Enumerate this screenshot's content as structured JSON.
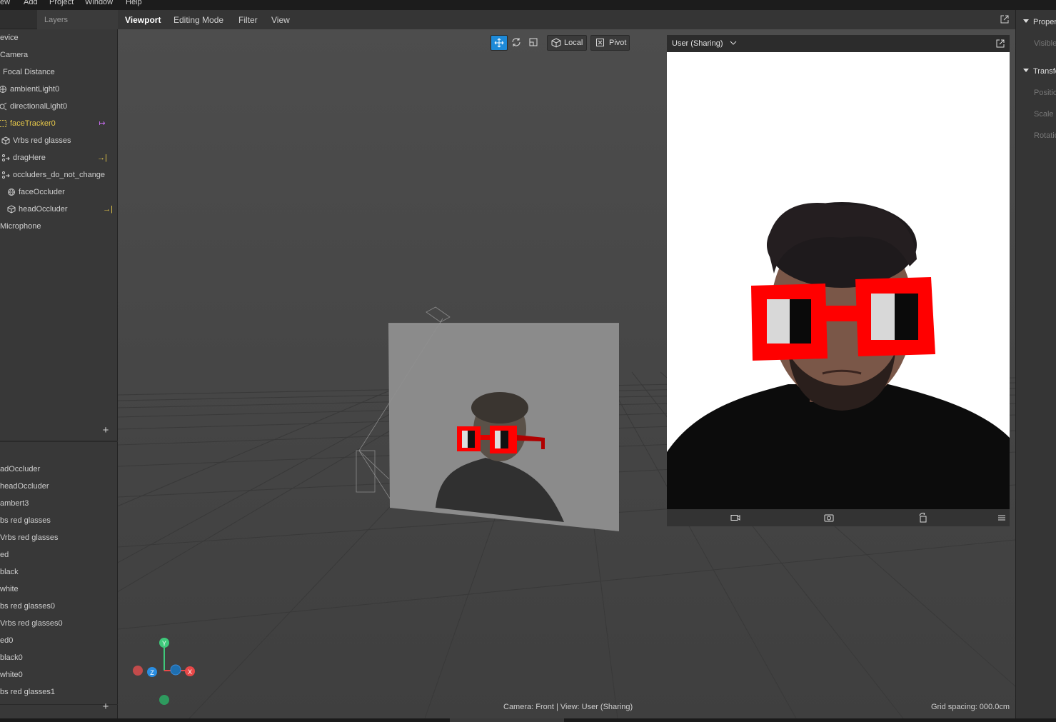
{
  "menu": [
    "ew",
    "Add",
    "Project",
    "Window",
    "Help"
  ],
  "layers_tab": "Layers",
  "scene_tree": [
    {
      "label": "evice",
      "icon": "none",
      "selected": false
    },
    {
      "label": "Camera",
      "icon": "none",
      "selected": false
    },
    {
      "label": "Focal Distance",
      "icon": "none",
      "selected": false
    },
    {
      "label": "ambientLight0",
      "icon": "ambient-light-icon",
      "selected": false
    },
    {
      "label": "directionalLight0",
      "icon": "directional-light-icon",
      "selected": false
    },
    {
      "label": "faceTracker0",
      "icon": "face-tracker-icon",
      "selected": true,
      "action": "↦"
    },
    {
      "label": "Vrbs red glasses",
      "icon": "cube-icon",
      "selected": false
    },
    {
      "label": "dragHere",
      "icon": "null-object-icon",
      "selected": false,
      "action": "→|"
    },
    {
      "label": "occluders_do_not_change",
      "icon": "null-object-icon",
      "selected": false
    },
    {
      "label": "faceOccluder",
      "icon": "face-mesh-icon",
      "selected": false
    },
    {
      "label": "headOccluder",
      "icon": "cube-icon",
      "selected": false,
      "action": "→|"
    },
    {
      "label": "Microphone",
      "icon": "none",
      "selected": false
    }
  ],
  "assets": [
    "adOccluder",
    "headOccluder",
    "ambert3",
    "bs red glasses",
    "Vrbs red glasses",
    "ed",
    "black",
    "white",
    "bs red glasses0",
    "Vrbs red glasses0",
    "ed0",
    "black0",
    "white0",
    "bs red glasses1"
  ],
  "add_label": "+",
  "viewport_tabs": [
    "Viewport",
    "Editing Mode",
    "Filter",
    "View"
  ],
  "toolbar": {
    "local": "Local",
    "pivot": "Pivot"
  },
  "preview": {
    "title": "User (Sharing)"
  },
  "axis_labels": {
    "y": "Y",
    "z": "Z",
    "x": "X"
  },
  "status": "Camera: Front | View: User (Sharing)",
  "grid_spacing": "Grid spacing: 000.0cm",
  "right_panel": {
    "properties": "Proper",
    "visible": "Visible",
    "transform": "Transfo",
    "position": "Positio",
    "scale": "Scale",
    "rotation": "Rotatio"
  },
  "colors": {
    "accent": "#1e8ad8",
    "selected": "#e6c84a",
    "glasses": "#ff0000"
  }
}
